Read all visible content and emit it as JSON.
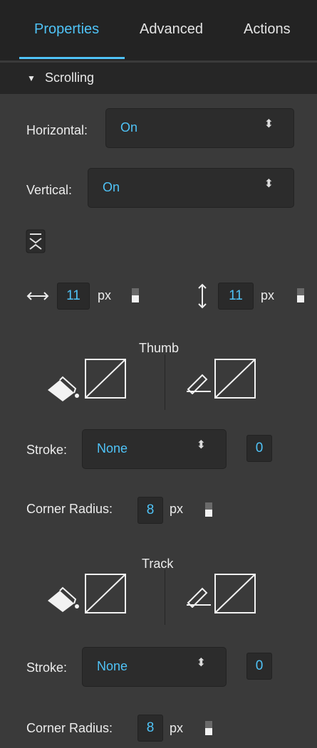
{
  "tabs": [
    {
      "label": "Properties",
      "active": true
    },
    {
      "label": "Advanced",
      "active": false
    },
    {
      "label": "Actions",
      "active": false
    }
  ],
  "section": {
    "title": "Scrolling"
  },
  "horizontal": {
    "label": "Horizontal:",
    "value": "On"
  },
  "vertical": {
    "label": "Vertical:",
    "value": "On"
  },
  "dims": {
    "width": "11",
    "height": "11",
    "unit": "px"
  },
  "thumb": {
    "title": "Thumb",
    "stroke_label": "Stroke:",
    "stroke_value": "None",
    "stroke_width": "0",
    "radius_label": "Corner Radius:",
    "radius_value": "8",
    "radius_unit": "px"
  },
  "track": {
    "title": "Track",
    "stroke_label": "Stroke:",
    "stroke_value": "None",
    "stroke_width": "0",
    "radius_label": "Corner Radius:",
    "radius_value": "8",
    "radius_unit": "px"
  },
  "colors": {
    "accent": "#4fc3f7",
    "panel": "#3a3a3a",
    "tabbar": "#232323"
  }
}
